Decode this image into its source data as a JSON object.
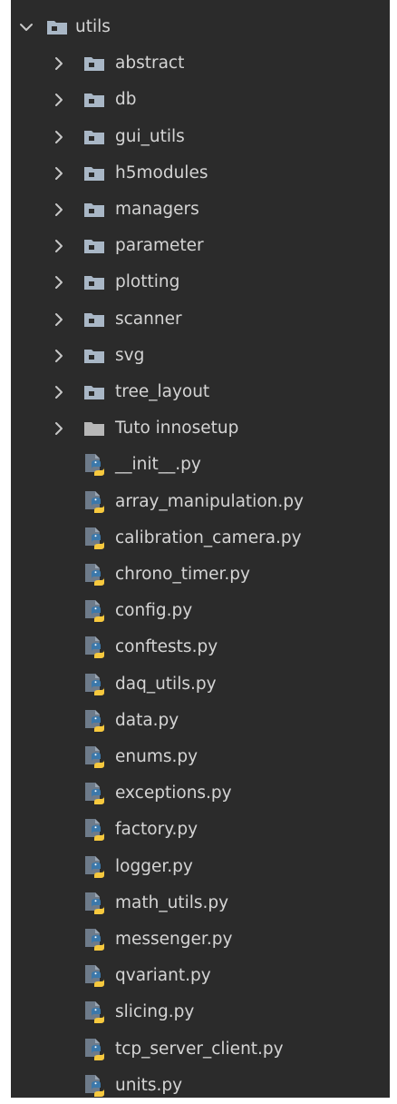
{
  "colors": {
    "background": "#2b2b2b",
    "text": "#d4d4d4",
    "chevron": "#c8c8c8",
    "folder": "#a9b7c6",
    "folder_plain": "#b7b7b7",
    "py_doc": "#6e7b8a",
    "python_blue": "#3c78aa",
    "python_yellow": "#f7c93e"
  },
  "tree": {
    "root": {
      "label": "utils",
      "expanded": true,
      "icon": "package-folder-icon"
    },
    "folders": [
      {
        "label": "abstract",
        "icon": "package-folder-icon",
        "expanded": false
      },
      {
        "label": "db",
        "icon": "package-folder-icon",
        "expanded": false
      },
      {
        "label": "gui_utils",
        "icon": "package-folder-icon",
        "expanded": false
      },
      {
        "label": "h5modules",
        "icon": "package-folder-icon",
        "expanded": false
      },
      {
        "label": "managers",
        "icon": "package-folder-icon",
        "expanded": false
      },
      {
        "label": "parameter",
        "icon": "package-folder-icon",
        "expanded": false
      },
      {
        "label": "plotting",
        "icon": "package-folder-icon",
        "expanded": false
      },
      {
        "label": "scanner",
        "icon": "package-folder-icon",
        "expanded": false
      },
      {
        "label": "svg",
        "icon": "package-folder-icon",
        "expanded": false
      },
      {
        "label": "tree_layout",
        "icon": "package-folder-icon",
        "expanded": false
      },
      {
        "label": "Tuto innosetup",
        "icon": "folder-icon",
        "expanded": false
      }
    ],
    "files": [
      {
        "label": "__init__.py",
        "icon": "python-file-icon"
      },
      {
        "label": "array_manipulation.py",
        "icon": "python-file-icon"
      },
      {
        "label": "calibration_camera.py",
        "icon": "python-file-icon"
      },
      {
        "label": "chrono_timer.py",
        "icon": "python-file-icon"
      },
      {
        "label": "config.py",
        "icon": "python-file-icon"
      },
      {
        "label": "conftests.py",
        "icon": "python-file-icon"
      },
      {
        "label": "daq_utils.py",
        "icon": "python-file-icon"
      },
      {
        "label": "data.py",
        "icon": "python-file-icon"
      },
      {
        "label": "enums.py",
        "icon": "python-file-icon"
      },
      {
        "label": "exceptions.py",
        "icon": "python-file-icon"
      },
      {
        "label": "factory.py",
        "icon": "python-file-icon"
      },
      {
        "label": "logger.py",
        "icon": "python-file-icon"
      },
      {
        "label": "math_utils.py",
        "icon": "python-file-icon"
      },
      {
        "label": "messenger.py",
        "icon": "python-file-icon"
      },
      {
        "label": "qvariant.py",
        "icon": "python-file-icon"
      },
      {
        "label": "slicing.py",
        "icon": "python-file-icon"
      },
      {
        "label": "tcp_server_client.py",
        "icon": "python-file-icon"
      },
      {
        "label": "units.py",
        "icon": "python-file-icon"
      }
    ]
  }
}
